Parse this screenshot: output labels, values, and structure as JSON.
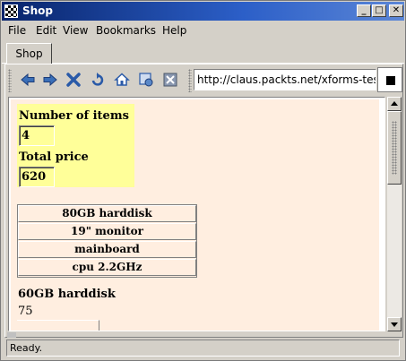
{
  "window": {
    "title": "Shop",
    "minimize": "_",
    "maximize": "□",
    "close": "✕"
  },
  "menu": [
    "File",
    "Edit",
    "View",
    "Bookmarks",
    "Help"
  ],
  "tabs": [
    {
      "label": "Shop"
    }
  ],
  "toolbar": {
    "buttons": [
      "back-icon",
      "forward-icon",
      "stop-icon",
      "reload-icon",
      "home-icon",
      "save-icon",
      "close-tab-icon"
    ],
    "url": "http://claus.packts.net/xforms-test-su"
  },
  "form": {
    "items_label": "Number of items",
    "items_value": "4",
    "total_label": "Total price",
    "total_value": "620",
    "items": [
      "80GB harddisk",
      "19\" monitor",
      "mainboard",
      "cpu 2.2GHz"
    ],
    "selected_name": "60GB harddisk",
    "selected_price": "75"
  },
  "status": "Ready.",
  "colors": {
    "accent": "#08246b",
    "page_bg": "#ffeee0",
    "summary_bg": "#ffff99"
  }
}
